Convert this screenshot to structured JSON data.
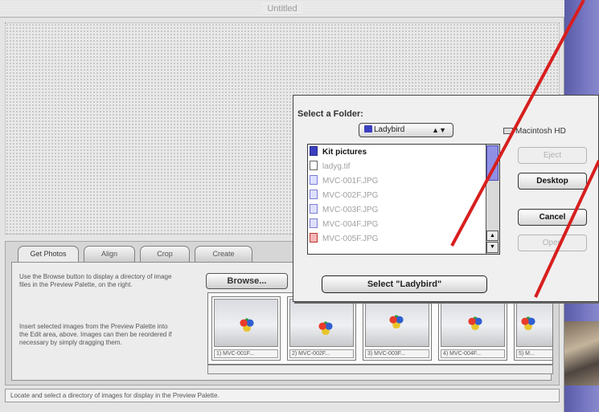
{
  "window": {
    "title": "Untitled"
  },
  "tabs": [
    {
      "label": "Get Photos",
      "active": true
    },
    {
      "label": "Align",
      "active": false
    },
    {
      "label": "Crop",
      "active": false
    },
    {
      "label": "Create",
      "active": false
    }
  ],
  "get_photos": {
    "help_browse": "Use the Browse button to display a directory of image files in the Preview Palette, on the right.",
    "help_insert": "Insert selected images from the Preview Palette into the Edit area, above. Images can then be reordered if necessary by simply dragging them.",
    "browse_label": "Browse..."
  },
  "thumbnails": [
    {
      "label": "1) MVC-001F..."
    },
    {
      "label": "2) MVC-002F..."
    },
    {
      "label": "3) MVC-003F..."
    },
    {
      "label": "4) MVC-004F..."
    },
    {
      "label": "5) M..."
    }
  ],
  "status_text": "Locate and select a directory of images for display in the Preview Palette.",
  "dialog": {
    "heading": "Select a Folder:",
    "folder_popup": "Ladybird",
    "disk_name": "Macintosh HD",
    "files": [
      {
        "name": "Kit pictures",
        "kind": "folder"
      },
      {
        "name": "ladyg.tif",
        "kind": "doc"
      },
      {
        "name": "MVC-001F.JPG",
        "kind": "jpg"
      },
      {
        "name": "MVC-002F.JPG",
        "kind": "jpg"
      },
      {
        "name": "MVC-003F.JPG",
        "kind": "jpg"
      },
      {
        "name": "MVC-004F.JPG",
        "kind": "jpg"
      },
      {
        "name": "MVC-005F.JPG",
        "kind": "jpg-red"
      }
    ],
    "buttons": {
      "eject": "Eject",
      "desktop": "Desktop",
      "cancel": "Cancel",
      "open": "Open"
    },
    "select_button": "Select \"Ladybird\""
  },
  "colors": {
    "annotation_red": "#d81e1e",
    "dialog_accent": "#3b3fbf",
    "side_purple": "#6d6ebc"
  }
}
